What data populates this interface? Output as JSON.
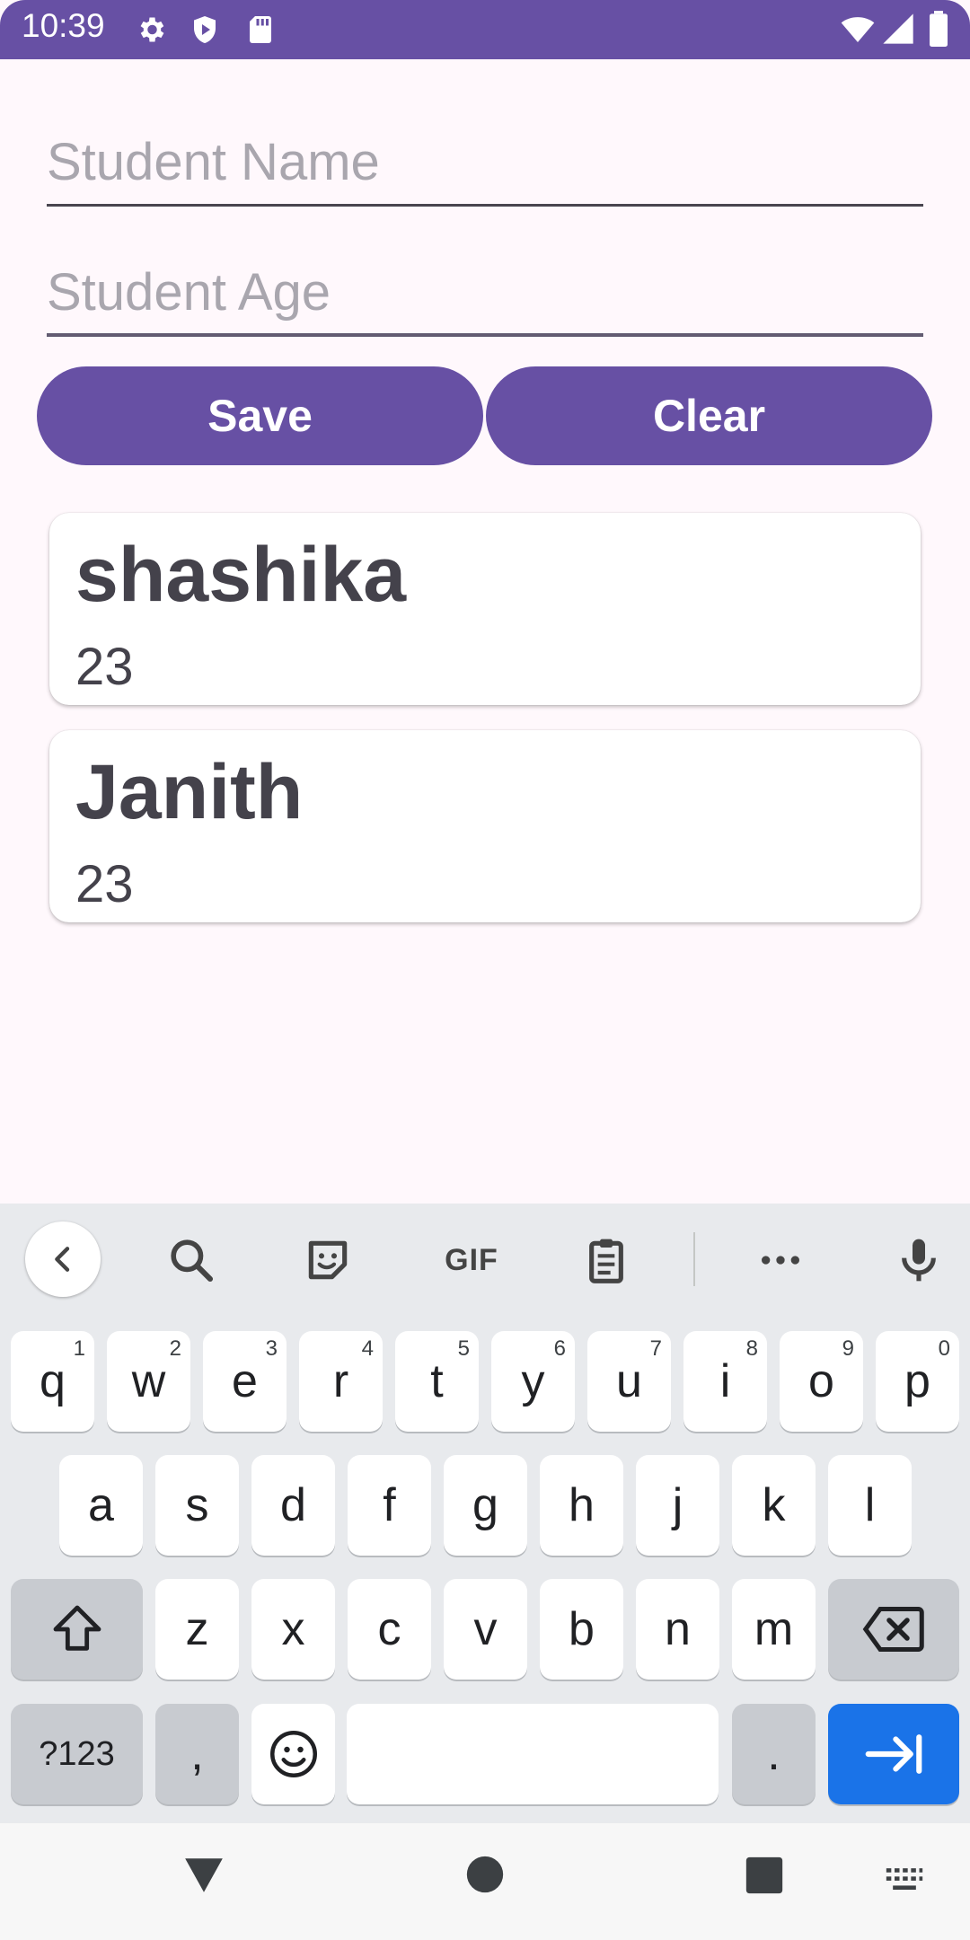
{
  "status_bar": {
    "time": "10:39"
  },
  "form": {
    "name_placeholder": "Student Name",
    "name_value": "",
    "age_placeholder": "Student Age",
    "age_value": ""
  },
  "buttons": {
    "save": "Save",
    "clear": "Clear"
  },
  "students": [
    {
      "name": "shashika",
      "age": "23"
    },
    {
      "name": "Janith",
      "age": "23"
    }
  ],
  "keyboard": {
    "toolbar_gif": "GIF",
    "row1": [
      {
        "k": "q",
        "h": "1"
      },
      {
        "k": "w",
        "h": "2"
      },
      {
        "k": "e",
        "h": "3"
      },
      {
        "k": "r",
        "h": "4"
      },
      {
        "k": "t",
        "h": "5"
      },
      {
        "k": "y",
        "h": "6"
      },
      {
        "k": "u",
        "h": "7"
      },
      {
        "k": "i",
        "h": "8"
      },
      {
        "k": "o",
        "h": "9"
      },
      {
        "k": "p",
        "h": "0"
      }
    ],
    "row2": [
      "a",
      "s",
      "d",
      "f",
      "g",
      "h",
      "j",
      "k",
      "l"
    ],
    "row3": [
      "z",
      "x",
      "c",
      "v",
      "b",
      "n",
      "m"
    ],
    "symbols_label": "?123",
    "comma": ",",
    "period": "."
  },
  "colors": {
    "primary": "#6750A4",
    "background": "#FFF8FC",
    "card": "#FFFFFF",
    "keyboard_bg": "#E8EAED",
    "enter_key": "#1A73E8"
  },
  "icons": {
    "status_left": [
      "settings-icon",
      "shield-icon",
      "sd-card-icon"
    ],
    "status_right": [
      "wifi-icon",
      "signal-icon",
      "battery-icon"
    ],
    "toolbar": [
      "back-chevron-icon",
      "search-icon",
      "sticker-icon",
      "gif-icon",
      "clipboard-icon",
      "more-icon",
      "mic-icon"
    ],
    "nav": [
      "back-triangle-icon",
      "home-circle-icon",
      "recents-square-icon",
      "keyboard-switch-icon"
    ]
  }
}
